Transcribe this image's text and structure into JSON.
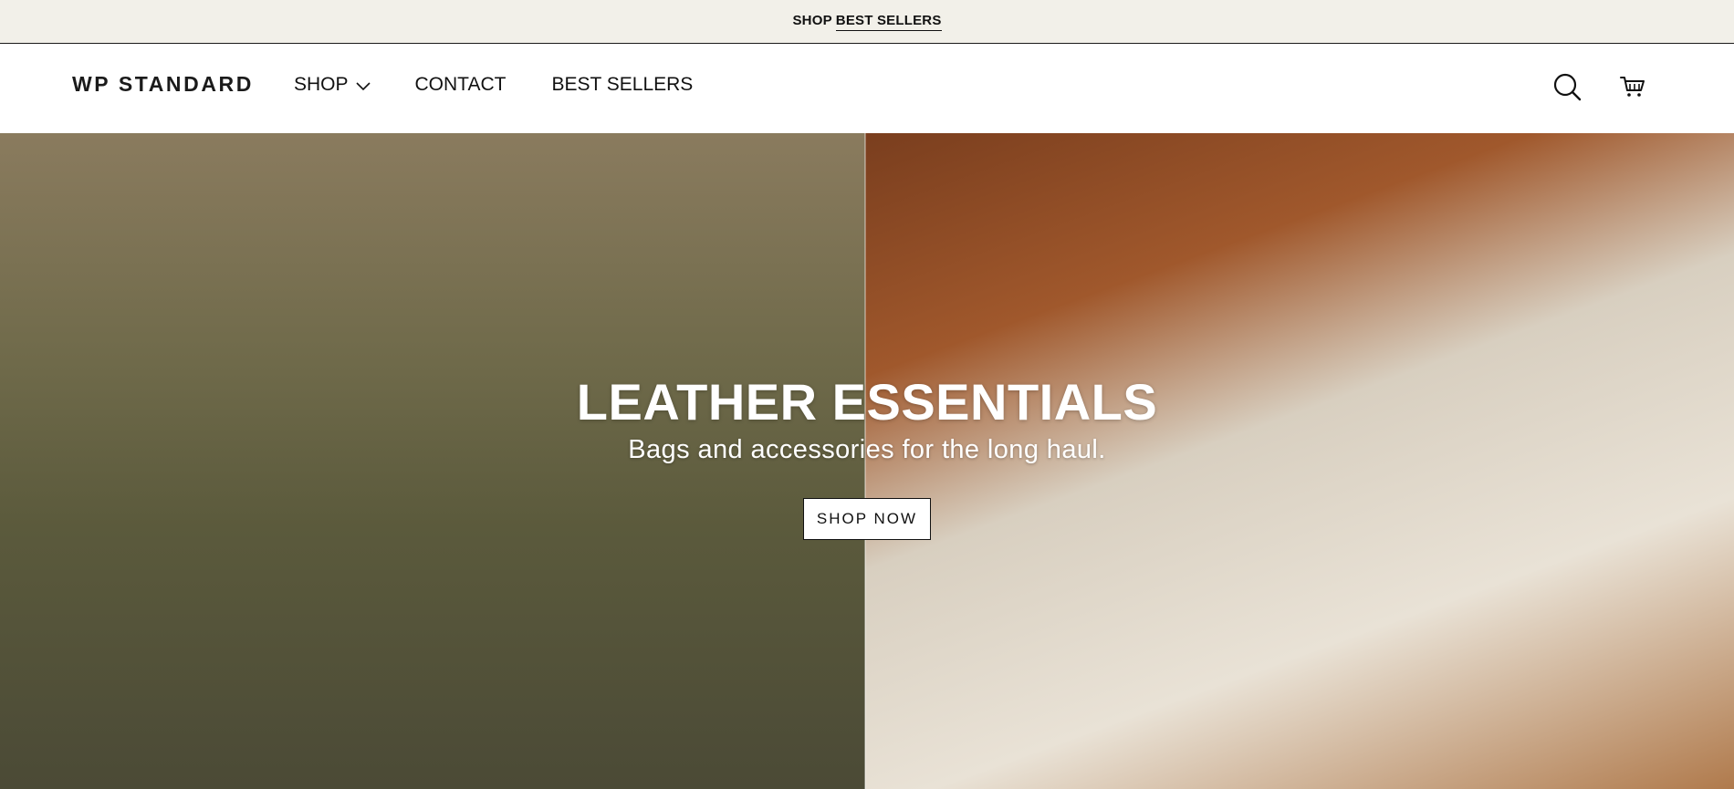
{
  "announcement": {
    "prefix": "SHOP",
    "link": "BEST SELLERS"
  },
  "header": {
    "logo": "WP STANDARD",
    "nav": {
      "shop": "SHOP",
      "contact": "CONTACT",
      "best_sellers": "BEST SELLERS"
    },
    "icons": {
      "search": "search-icon",
      "cart": "cart-icon"
    }
  },
  "hero": {
    "title": "LEATHER ESSENTIALS",
    "subtitle": "Bags and accessories for the long haul.",
    "cta": "SHOP NOW"
  },
  "colors": {
    "announcement_bg": "#f2f0e9",
    "text": "#111111"
  }
}
